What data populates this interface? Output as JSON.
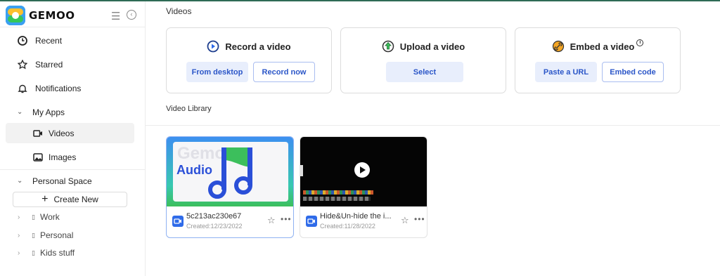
{
  "app": {
    "brand": "GEMOO"
  },
  "sidebar": {
    "items": [
      {
        "label": "Recent",
        "icon": "clock-icon"
      },
      {
        "label": "Starred",
        "icon": "star-icon"
      },
      {
        "label": "Notifications",
        "icon": "bell-icon"
      }
    ],
    "my_apps": {
      "label": "My Apps",
      "children": [
        {
          "label": "Videos",
          "icon": "video-icon"
        },
        {
          "label": "Images",
          "icon": "image-icon"
        }
      ]
    },
    "personal_space": {
      "label": "Personal Space"
    },
    "create_new": "Create New",
    "folders": [
      "Work",
      "Personal",
      "Kids stuff"
    ]
  },
  "main": {
    "title": "Videos",
    "cards": [
      {
        "title": "Record a video",
        "icon": "record-play-icon",
        "buttons": [
          "From desktop",
          "Record now"
        ]
      },
      {
        "title": "Upload a video",
        "icon": "upload-arrow-icon",
        "buttons": [
          "Select"
        ]
      },
      {
        "title": "Embed a video",
        "icon": "link-icon",
        "buttons": [
          "Paste a URL",
          "Embed code"
        ]
      }
    ],
    "library_title": "Video Library",
    "videos": [
      {
        "name": "5c213ac230e67",
        "created": "Created:12/23/2022",
        "thumb_text": "Gemoo",
        "thumb_sub": "Audio"
      },
      {
        "name": "Hide&Un-hide the i...",
        "created": "Created:11/28/2022"
      }
    ]
  },
  "colors": {
    "accent": "#2b56c8",
    "selected_border": "#8fb2f2",
    "brand_green": "#3cbf5c",
    "video_icon": "#2f6be9"
  }
}
